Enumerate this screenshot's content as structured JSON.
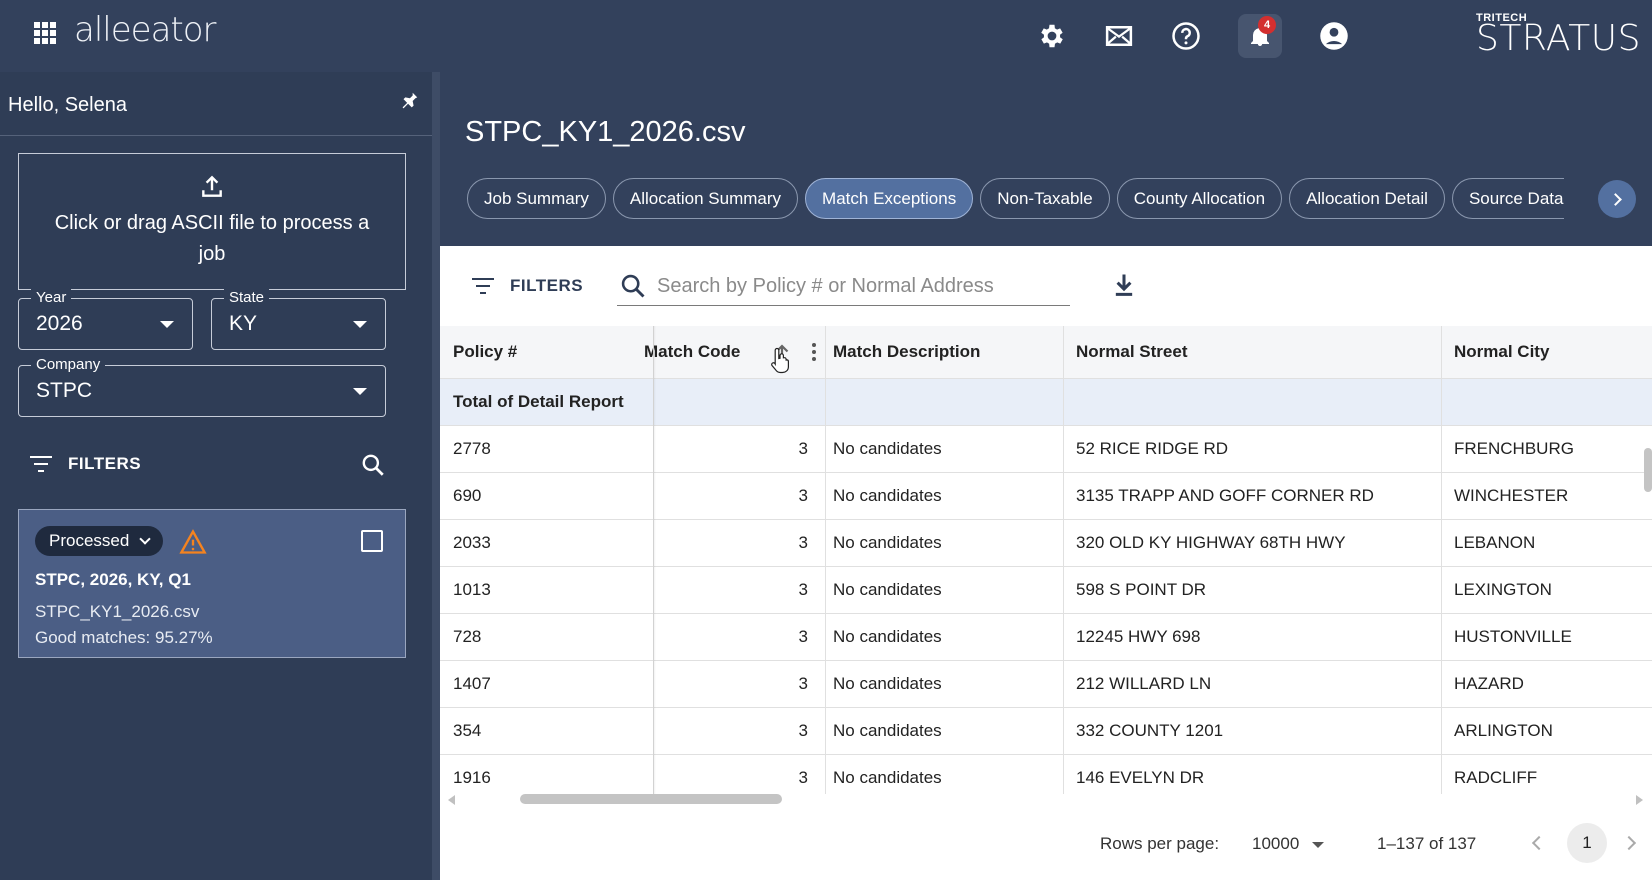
{
  "app": {
    "logo": "alleeator",
    "brand_small": "TRITECH",
    "brand_large": "STRATUS",
    "notification_count": "4"
  },
  "sidebar": {
    "greeting": "Hello, Selena",
    "upload_text": "Click or drag ASCII file to process a job",
    "year": {
      "label": "Year",
      "value": "2026"
    },
    "state": {
      "label": "State",
      "value": "KY"
    },
    "company": {
      "label": "Company",
      "value": "STPC"
    },
    "filters_label": "FILTERS",
    "job": {
      "status": "Processed",
      "title": "STPC, 2026, KY, Q1",
      "file": "STPC_KY1_2026.csv",
      "matches": "Good matches: 95.27%"
    }
  },
  "main": {
    "file_title": "STPC_KY1_2026.csv",
    "tabs": [
      {
        "label": "Job Summary"
      },
      {
        "label": "Allocation Summary"
      },
      {
        "label": "Match Exceptions"
      },
      {
        "label": "Non-Taxable"
      },
      {
        "label": "County Allocation"
      },
      {
        "label": "Allocation Detail"
      },
      {
        "label": "Source Data"
      }
    ],
    "filters_label": "FILTERS",
    "search_placeholder": "Search by Policy # or Normal Address",
    "columns": [
      "Policy #",
      "Match Code",
      "Match Description",
      "Normal Street",
      "Normal City"
    ],
    "total_label": "Total of Detail Report",
    "rows": [
      {
        "policy": "2778",
        "code": "3",
        "desc": "No candidates",
        "street": "52 RICE RIDGE RD",
        "city": "FRENCHBURG"
      },
      {
        "policy": "690",
        "code": "3",
        "desc": "No candidates",
        "street": "3135 TRAPP AND GOFF CORNER RD",
        "city": "WINCHESTER"
      },
      {
        "policy": "2033",
        "code": "3",
        "desc": "No candidates",
        "street": "320 OLD KY HIGHWAY 68TH HWY",
        "city": "LEBANON"
      },
      {
        "policy": "1013",
        "code": "3",
        "desc": "No candidates",
        "street": "598 S POINT DR",
        "city": "LEXINGTON"
      },
      {
        "policy": "728",
        "code": "3",
        "desc": "No candidates",
        "street": "12245 HWY 698",
        "city": "HUSTONVILLE"
      },
      {
        "policy": "1407",
        "code": "3",
        "desc": "No candidates",
        "street": "212 WILLARD LN",
        "city": "HAZARD"
      },
      {
        "policy": "354",
        "code": "3",
        "desc": "No candidates",
        "street": "332 COUNTY 1201",
        "city": "ARLINGTON"
      },
      {
        "policy": "1916",
        "code": "3",
        "desc": "No candidates",
        "street": "146 EVELYN DR",
        "city": "RADCLIFF"
      }
    ],
    "pagination": {
      "rows_per_page_label": "Rows per page:",
      "rows_per_page": "10000",
      "range": "1–137 of 137",
      "page": "1"
    }
  }
}
